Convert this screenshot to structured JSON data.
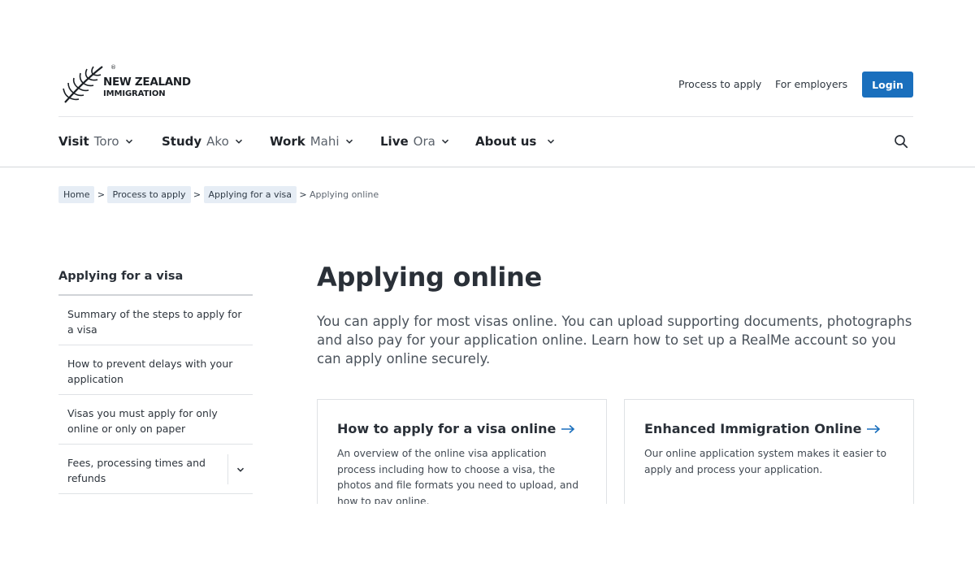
{
  "brand": {
    "line1": "NEW ZEALAND",
    "line2": "IMMIGRATION",
    "reg": "®"
  },
  "header": {
    "process_link": "Process to apply",
    "employers_link": "For employers",
    "login_label": "Login",
    "accent": "#1a6fbd"
  },
  "nav": [
    {
      "en": "Visit",
      "mi": "Toro"
    },
    {
      "en": "Study",
      "mi": "Ako"
    },
    {
      "en": "Work",
      "mi": "Mahi"
    },
    {
      "en": "Live",
      "mi": "Ora"
    },
    {
      "en": "About us",
      "mi": ""
    }
  ],
  "breadcrumb": {
    "items": [
      "Home",
      "Process to apply",
      "Applying for a visa"
    ],
    "separator": ">",
    "current": "Applying online"
  },
  "sidebar": {
    "title": "Applying for a visa",
    "items": [
      {
        "label": "Summary of the steps to apply for a visa"
      },
      {
        "label": "How to prevent delays with your application"
      },
      {
        "label": "Visas you must apply for only online or only on paper"
      },
      {
        "label": "Fees, processing times and refunds"
      }
    ]
  },
  "main": {
    "title": "Applying online",
    "intro": "You can apply for most visas online. You can upload supporting documents, photographs and also pay for your application online. Learn how to set up a RealMe account so you can apply online securely.",
    "cards": [
      {
        "title": "How to apply for a visa online",
        "desc": "An overview of the online visa application process including how to choose a visa, the photos and file formats you need to upload, and how to pay online."
      },
      {
        "title": "Enhanced Immigration Online",
        "desc": "Our online application system makes it easier to apply and process your application."
      }
    ]
  }
}
